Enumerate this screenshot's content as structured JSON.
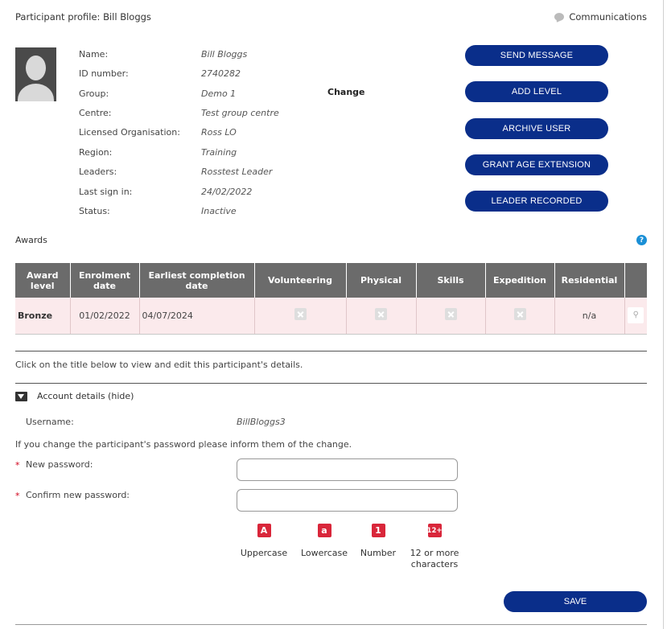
{
  "header": {
    "title": "Participant profile: Bill Bloggs",
    "communications_label": "Communications"
  },
  "profile": {
    "fields": [
      {
        "label": "Name:",
        "value": "Bill Bloggs"
      },
      {
        "label": "ID number:",
        "value": "2740282"
      },
      {
        "label": "Group:",
        "value": "Demo 1"
      },
      {
        "label": "Centre:",
        "value": "Test group centre"
      },
      {
        "label": "Licensed Organisation:",
        "value": "Ross LO"
      },
      {
        "label": "Region:",
        "value": "Training"
      },
      {
        "label": "Leaders:",
        "value": "Rosstest Leader"
      },
      {
        "label": "Last sign in:",
        "value": "24/02/2022"
      },
      {
        "label": "Status:",
        "value": "Inactive"
      }
    ],
    "change_label": "Change"
  },
  "actions": {
    "send_message": "SEND MESSAGE",
    "add_level": "ADD LEVEL",
    "archive_user": "ARCHIVE USER",
    "grant_age_extension": "GRANT AGE EXTENSION",
    "leader_recorded": "LEADER RECORDED"
  },
  "awards": {
    "title": "Awards",
    "help_icon": "?",
    "columns": [
      "Award level",
      "Enrolment date",
      "Earliest completion date",
      "Volunteering",
      "Physical",
      "Skills",
      "Expedition",
      "Residential",
      ""
    ],
    "rows": [
      {
        "level": "Bronze",
        "enrolment": "01/02/2022",
        "earliest": "04/07/2024",
        "residential": "n/a"
      }
    ]
  },
  "details_intro": "Click on the title below to view and edit this participant's details.",
  "account": {
    "toggle_label": "Account details (hide)",
    "username_label": "Username:",
    "username_value": "BillBloggs3",
    "password_note": "If you change the participant's password please inform them of the change.",
    "required_mark": "*",
    "new_password_label": "New password:",
    "confirm_password_label": "Confirm new password:",
    "rules": [
      {
        "badge": "A",
        "label": "Uppercase"
      },
      {
        "badge": "a",
        "label": "Lowercase"
      },
      {
        "badge": "1",
        "label": "Number"
      },
      {
        "badge": "12+",
        "label": "12 or more characters"
      }
    ],
    "save_label": "SAVE"
  },
  "colors": {
    "primary_button": "#0a2e8a",
    "table_header": "#6b6b6b",
    "table_row": "#fbeaec",
    "required": "#d0021b",
    "rule_badge": "#d9263a",
    "help_icon": "#1a8fd6"
  }
}
